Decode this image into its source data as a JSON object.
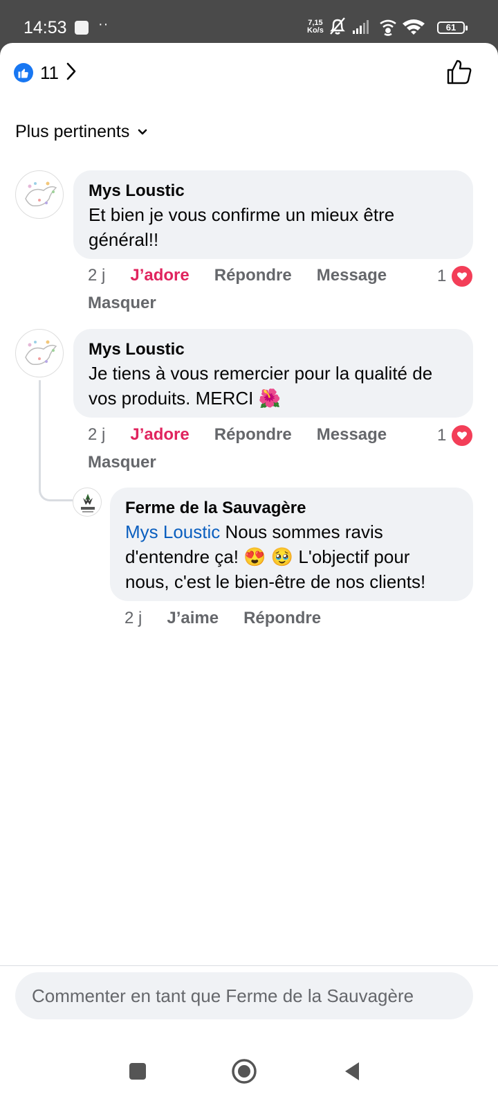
{
  "status_bar": {
    "time": "14:53",
    "net_speed_value": "7,15",
    "net_speed_unit": "Ko/s",
    "battery": "61"
  },
  "header": {
    "reaction_count": "11",
    "reaction_icon": "like-icon"
  },
  "sort": {
    "label": "Plus pertinents"
  },
  "comments": [
    {
      "author": "Mys Loustic",
      "text": "Et bien je vous confirme un mieux être général!!",
      "time": "2 j",
      "reaction_action": "J’adore",
      "reply_label": "Répondre",
      "message_label": "Message",
      "hide_label": "Masquer",
      "reaction_count": "1"
    },
    {
      "author": "Mys Loustic",
      "text": "Je tiens à vous remercier pour la qualité de vos produits. MERCI 🌺",
      "time": "2 j",
      "reaction_action": "J’adore",
      "reply_label": "Répondre",
      "message_label": "Message",
      "hide_label": "Masquer",
      "reaction_count": "1"
    }
  ],
  "reply": {
    "author": "Ferme de la Sauvagère",
    "mention": "Mys Loustic",
    "text": " Nous sommes ravis d'entendre ça! 😍 🥹 L'objectif pour nous, c'est le bien-être de nos clients!",
    "time": "2 j",
    "like_label": "J’aime",
    "reply_label": "Répondre"
  },
  "composer": {
    "placeholder": "Commenter en tant que Ferme de la Sauvagère"
  },
  "colors": {
    "like_blue": "#1877f2",
    "love_red": "#e0245e",
    "mention_blue": "#0b5fbf",
    "bubble_gray": "#f0f2f5"
  }
}
